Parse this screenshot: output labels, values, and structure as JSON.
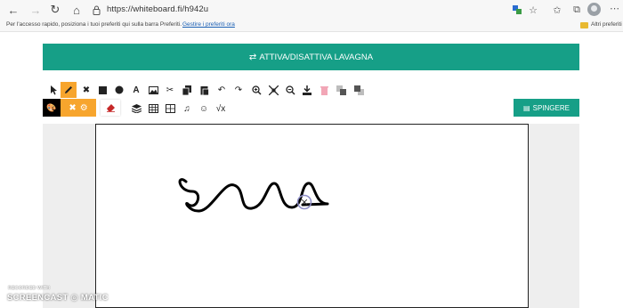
{
  "browser": {
    "url": "https://whiteboard.fi/h942u"
  },
  "favorites_bar": {
    "hint": "Per l'accesso rapido, posiziona i tuoi preferiti qui sulla barra Preferiti.",
    "manage_link": "Gestire i preferiti ora",
    "other_favorites": "Altri preferiti"
  },
  "banner": {
    "label": "ATTIVA/DISATTIVA LAVAGNA"
  },
  "toolbar": {
    "tools": [
      "select-icon",
      "pencil-icon",
      "shapes-tool-icon",
      "square-icon",
      "circle-icon",
      "text-icon",
      "image-icon",
      "cut-icon",
      "copy-icon",
      "paste-icon",
      "undo-icon",
      "redo-icon",
      "zoom-in-icon",
      "fit-screen-icon",
      "zoom-out-icon",
      "download-icon",
      "delete-icon",
      "bring-front-icon",
      "send-back-icon"
    ],
    "row2_tools": [
      "eraser-icon",
      "layers-icon",
      "table-icon",
      "grid-icon",
      "music-icon",
      "emoji-icon",
      "math-icon"
    ],
    "push_label": "SPINGERE"
  },
  "colors": {
    "accent": "#169f87",
    "highlight": "#f7a52d",
    "canvas_bg": "#eeeeee"
  },
  "watermark": {
    "recorded_with": "RECORDED WITH",
    "brand": "SCREENCAST ◎ MATIC"
  }
}
